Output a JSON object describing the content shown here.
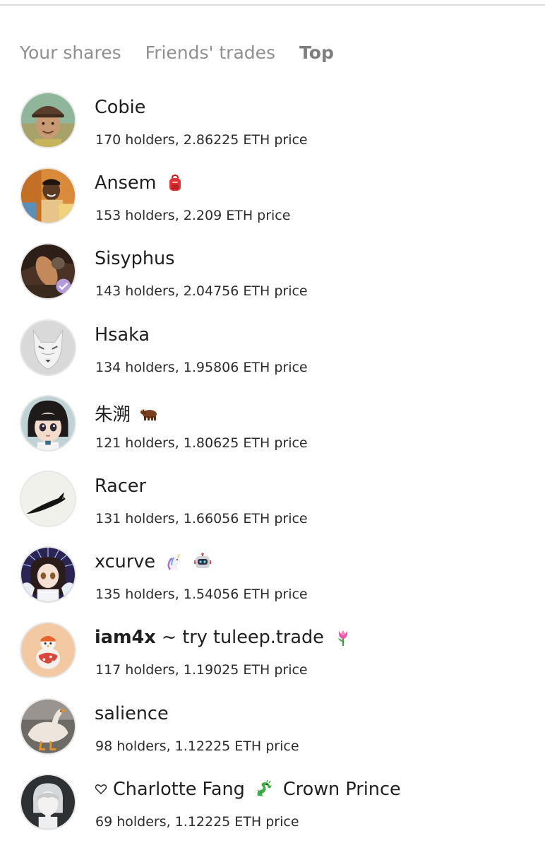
{
  "tabs": [
    {
      "label": "Your shares",
      "active": false
    },
    {
      "label": "Friends' trades",
      "active": false
    },
    {
      "label": "Top",
      "active": true
    }
  ],
  "users": [
    {
      "name": "Cobie",
      "stats": "170 holders, 2.86225 ETH price",
      "avatar": "avatar-cap-man",
      "emojis": []
    },
    {
      "name": "Ansem",
      "stats": "153 holders, 2.209 ETH price",
      "avatar": "avatar-laughing-man",
      "emojis": [
        "backpack-icon"
      ]
    },
    {
      "name": "Sisyphus",
      "stats": "143 holders, 2.04756 ETH price",
      "avatar": "avatar-painting",
      "emojis": []
    },
    {
      "name": "Hsaka",
      "stats": "134 holders, 1.95806 ETH price",
      "avatar": "avatar-white-wolf",
      "emojis": []
    },
    {
      "name": "朱溯",
      "stats": "121 holders, 1.80625 ETH price",
      "avatar": "avatar-anime-girl",
      "emojis": [
        "ox-icon"
      ]
    },
    {
      "name": "Racer",
      "stats": "131 holders, 1.66056 ETH price",
      "avatar": "avatar-koi-fish",
      "emojis": []
    },
    {
      "name": "xcurve",
      "stats": "135 holders, 1.54056 ETH price",
      "avatar": "avatar-anime-angel",
      "emojis": [
        "unicorn-icon",
        "robot-icon"
      ]
    },
    {
      "name_bold": "iam4x",
      "name_rest": " ~ try tuleep.trade",
      "stats": "117 holders, 1.19025 ETH price",
      "avatar": "avatar-penguin-egg",
      "emojis": [
        "tulip-icon"
      ]
    },
    {
      "name": "salience",
      "stats": "98 holders, 1.12225 ETH price",
      "avatar": "avatar-goose",
      "emojis": []
    },
    {
      "name_before": "Charlotte Fang",
      "name_after": "Crown Prince",
      "stats": "69 holders, 1.12225 ETH price",
      "avatar": "avatar-grey-hair-boy",
      "emojis": [
        "heart-outline-icon",
        "dragon-icon"
      ]
    }
  ]
}
